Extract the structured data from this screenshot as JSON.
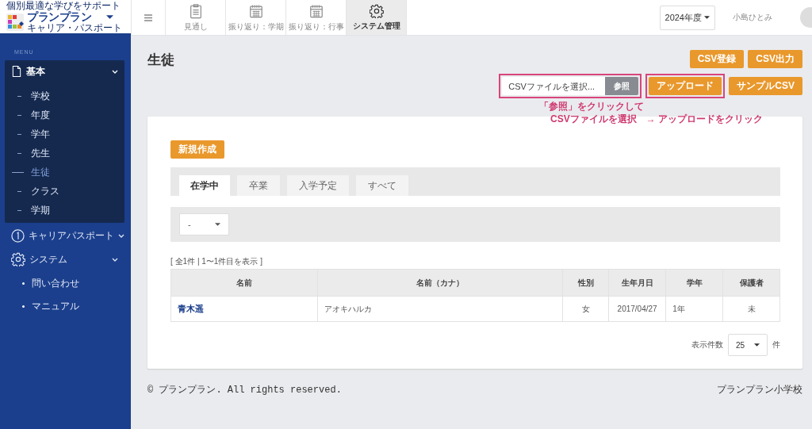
{
  "header": {
    "logo": {
      "tagline": "個別最適な学びをサポート",
      "name": "プランプラン",
      "subtitle": "キャリア・パスポート"
    },
    "tabs": [
      {
        "label": "見通し",
        "kind": "clipboard",
        "selected": false
      },
      {
        "label": "振り返り：学期",
        "kind": "calendar",
        "selected": false
      },
      {
        "label": "振り返り：行事",
        "kind": "calendar",
        "selected": false
      },
      {
        "label": "システム管理",
        "kind": "gear",
        "selected": true
      }
    ],
    "year": "2024年度",
    "user": "小島ひとみ"
  },
  "sidebar": {
    "menu_label": "MENU",
    "groups": [
      {
        "label": "基本",
        "kind": "document",
        "expanded": true,
        "children": [
          {
            "label": "学校",
            "selected": false
          },
          {
            "label": "年度",
            "selected": false
          },
          {
            "label": "学年",
            "selected": false
          },
          {
            "label": "先生",
            "selected": false
          },
          {
            "label": "生徒",
            "selected": true
          },
          {
            "label": "クラス",
            "selected": false
          },
          {
            "label": "学期",
            "selected": false
          }
        ]
      },
      {
        "label": "キャリアパスポート",
        "kind": "number",
        "expanded": false
      },
      {
        "label": "システム",
        "kind": "gear",
        "expanded": false
      }
    ],
    "links": [
      "問い合わせ",
      "マニュアル"
    ]
  },
  "main": {
    "title": "生徒",
    "top_buttons": [
      "CSV登録",
      "CSV出力"
    ],
    "file_input": {
      "placeholder": "CSVファイルを選択...",
      "browse": "参照"
    },
    "upload_button": "アップロード",
    "sample_button": "サンプルCSV",
    "annotation": [
      "「参照」をクリックして",
      "CSVファイルを選択　→ アップロードをクリック"
    ],
    "new_button": "新規作成",
    "tabs": [
      {
        "label": "在学中",
        "selected": true
      },
      {
        "label": "卒業",
        "selected": false
      },
      {
        "label": "入学予定",
        "selected": false
      },
      {
        "label": "すべて",
        "selected": false
      }
    ],
    "filter": "-",
    "count": "[ 全1件 | 1〜1件目を表示 ]",
    "table": {
      "columns": [
        "名前",
        "名前（カナ）",
        "性別",
        "生年月日",
        "学年",
        "保護者"
      ],
      "rows": [
        [
          "青木遥",
          "アオキハルカ",
          "女",
          "2017/04/27",
          "1年",
          "未"
        ]
      ]
    },
    "per_page": {
      "label": "表示件数",
      "value": "25",
      "unit": "件"
    }
  },
  "footer": {
    "copyright": "©  プランプラン. All rights reserved.",
    "school": "プランプラン小学校"
  }
}
